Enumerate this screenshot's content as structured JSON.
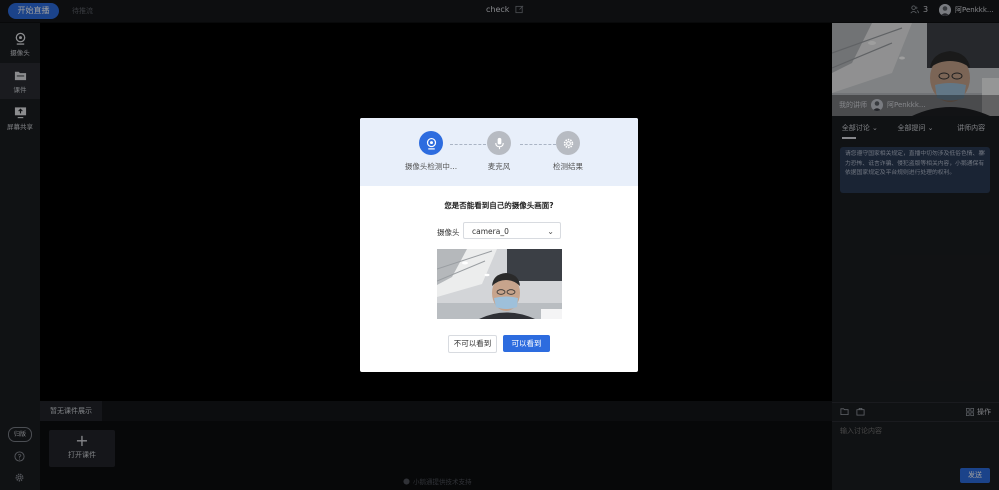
{
  "topbar": {
    "start_label": "开始直播",
    "status": "待推流",
    "title": "check",
    "people_count": "3",
    "user_name": "阿Penkkk..."
  },
  "sidebar": {
    "items": [
      {
        "label": "摄像头",
        "icon": "camera-icon"
      },
      {
        "label": "课件",
        "icon": "folder-icon"
      },
      {
        "label": "屏幕共享",
        "icon": "screen-share-icon"
      }
    ],
    "exit_label": "归版"
  },
  "courseware": {
    "tab_label": "暂无课件展示",
    "open_label": "打开课件",
    "tech_support": "小鹅通提供技术支持"
  },
  "right": {
    "caption_role": "我的讲师",
    "caption_name": "阿Penkkk...",
    "tabs": [
      {
        "label": "全部讨论 ⌄"
      },
      {
        "label": "全部提问 ⌄"
      },
      {
        "label": "讲师内容"
      }
    ],
    "notice": "请您遵守国家相关规定，直播中切勿涉及低俗色情、暴力恐怖、诋言诈骗、侵犯盗版等相关内容，小鹅通保有依据国家规定及平台规则进行处理的权利。",
    "ops_label": "操作",
    "input_placeholder": "输入讨论内容",
    "send_label": "发送"
  },
  "modal": {
    "steps": [
      {
        "label": "摄像头检测中...",
        "state": "active"
      },
      {
        "label": "麦克风",
        "state": "inactive"
      },
      {
        "label": "检测结果",
        "state": "inactive"
      }
    ],
    "question": "您是否能看到自己的摄像头画面?",
    "camera_label": "摄像头",
    "camera_value": "camera_0",
    "no_label": "不可以看到",
    "yes_label": "可以看到"
  },
  "colors": {
    "accent": "#2d6cdf",
    "sidebar_bg": "#1b1d21",
    "modal_header": "#e8effa"
  }
}
